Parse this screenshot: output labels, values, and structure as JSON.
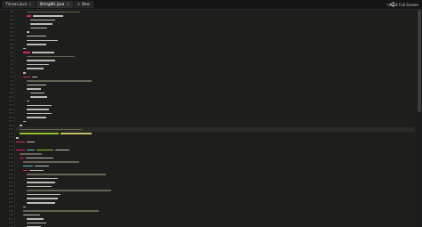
{
  "tabs": [
    {
      "label": "TVrows.java",
      "active": false
    },
    {
      "label": "StringWL.java",
      "active": true
    },
    {
      "label": "New",
      "active": false
    }
  ],
  "header": {
    "exit_fullscreen_label": "Exit Full Screen",
    "share_icon": "share-icon",
    "exit_icon": "exit-icon"
  },
  "colors": {
    "keyword": "#f92672",
    "type": "#66d9ef",
    "string": "#e6db74",
    "comment": "#75715e",
    "background": "#1e1f1c"
  },
  "first_line_number": 80,
  "scroll_fraction": 0.45
}
